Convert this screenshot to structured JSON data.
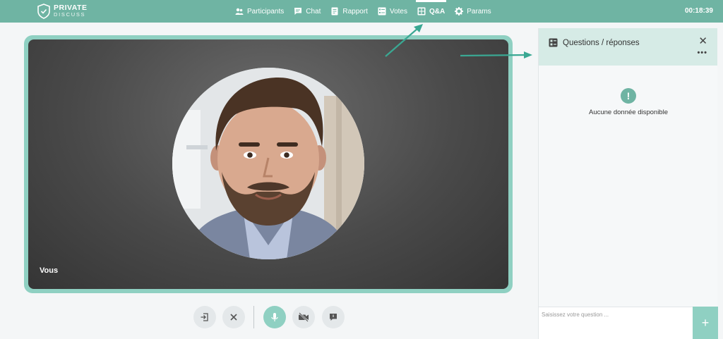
{
  "brand": {
    "line1": "PRIVATE",
    "line2": "DISCUSS"
  },
  "nav": {
    "items": [
      {
        "label": "Participants",
        "icon": "users-icon"
      },
      {
        "label": "Chat",
        "icon": "chat-icon"
      },
      {
        "label": "Rapport",
        "icon": "report-icon"
      },
      {
        "label": "Votes",
        "icon": "votes-icon"
      },
      {
        "label": "Q&A",
        "icon": "qa-icon"
      },
      {
        "label": "Params",
        "icon": "gear-icon"
      }
    ],
    "active": "Q&A"
  },
  "timer": "00:18:39",
  "video": {
    "label": "Vous"
  },
  "panel": {
    "title": "Questions / réponses",
    "empty_text": "Aucune donnée disponible",
    "input_placeholder": "Saisissez votre question ...",
    "add_label": "+"
  },
  "colors": {
    "accent": "#6fb4a3",
    "accent_light": "#8fd0c2",
    "panel_header": "#d6ebe6"
  }
}
